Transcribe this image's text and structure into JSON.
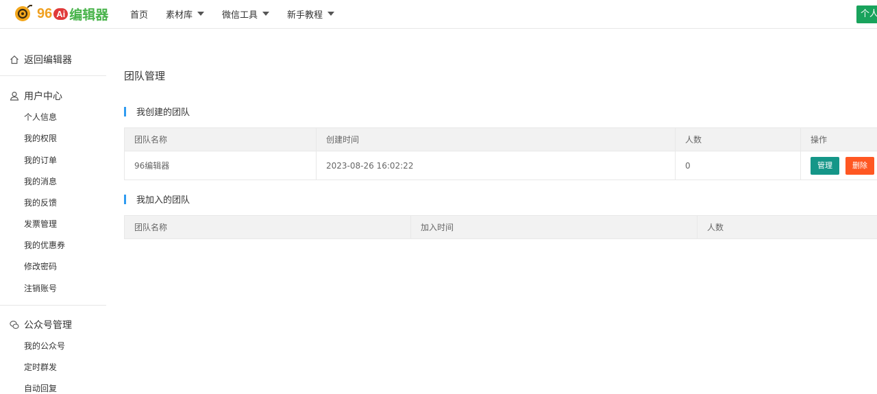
{
  "header": {
    "logo_number": "96",
    "logo_badge": "Ai",
    "logo_text": "编辑器",
    "nav": [
      {
        "label": "首页"
      },
      {
        "label": "素材库"
      },
      {
        "label": "微信工具"
      },
      {
        "label": "新手教程"
      }
    ],
    "user_button": "个人"
  },
  "sidebar": {
    "back": "返回编辑器",
    "user_center": {
      "title": "用户中心",
      "items": [
        "个人信息",
        "我的权限",
        "我的订单",
        "我的消息",
        "我的反馈",
        "发票管理",
        "我的优惠券",
        "修改密码",
        "注销账号"
      ]
    },
    "mp_manage": {
      "title": "公众号管理",
      "items": [
        "我的公众号",
        "定时群发",
        "自动回复"
      ]
    }
  },
  "main": {
    "title": "团队管理",
    "created": {
      "title": "我创建的团队",
      "columns": [
        "团队名称",
        "创建时间",
        "人数",
        "操作"
      ],
      "rows": [
        {
          "name": "96编辑器",
          "time": "2023-08-26 16:02:22",
          "count": "0"
        }
      ],
      "manage_label": "管理",
      "delete_label": "删除"
    },
    "joined": {
      "title": "我加入的团队",
      "columns": [
        "团队名称",
        "加入时间",
        "人数"
      ]
    }
  },
  "colors": {
    "accent_green": "#19a35c",
    "manage_button": "#159688",
    "delete_button": "#ff5722",
    "section_bar": "#2f9bf0"
  }
}
